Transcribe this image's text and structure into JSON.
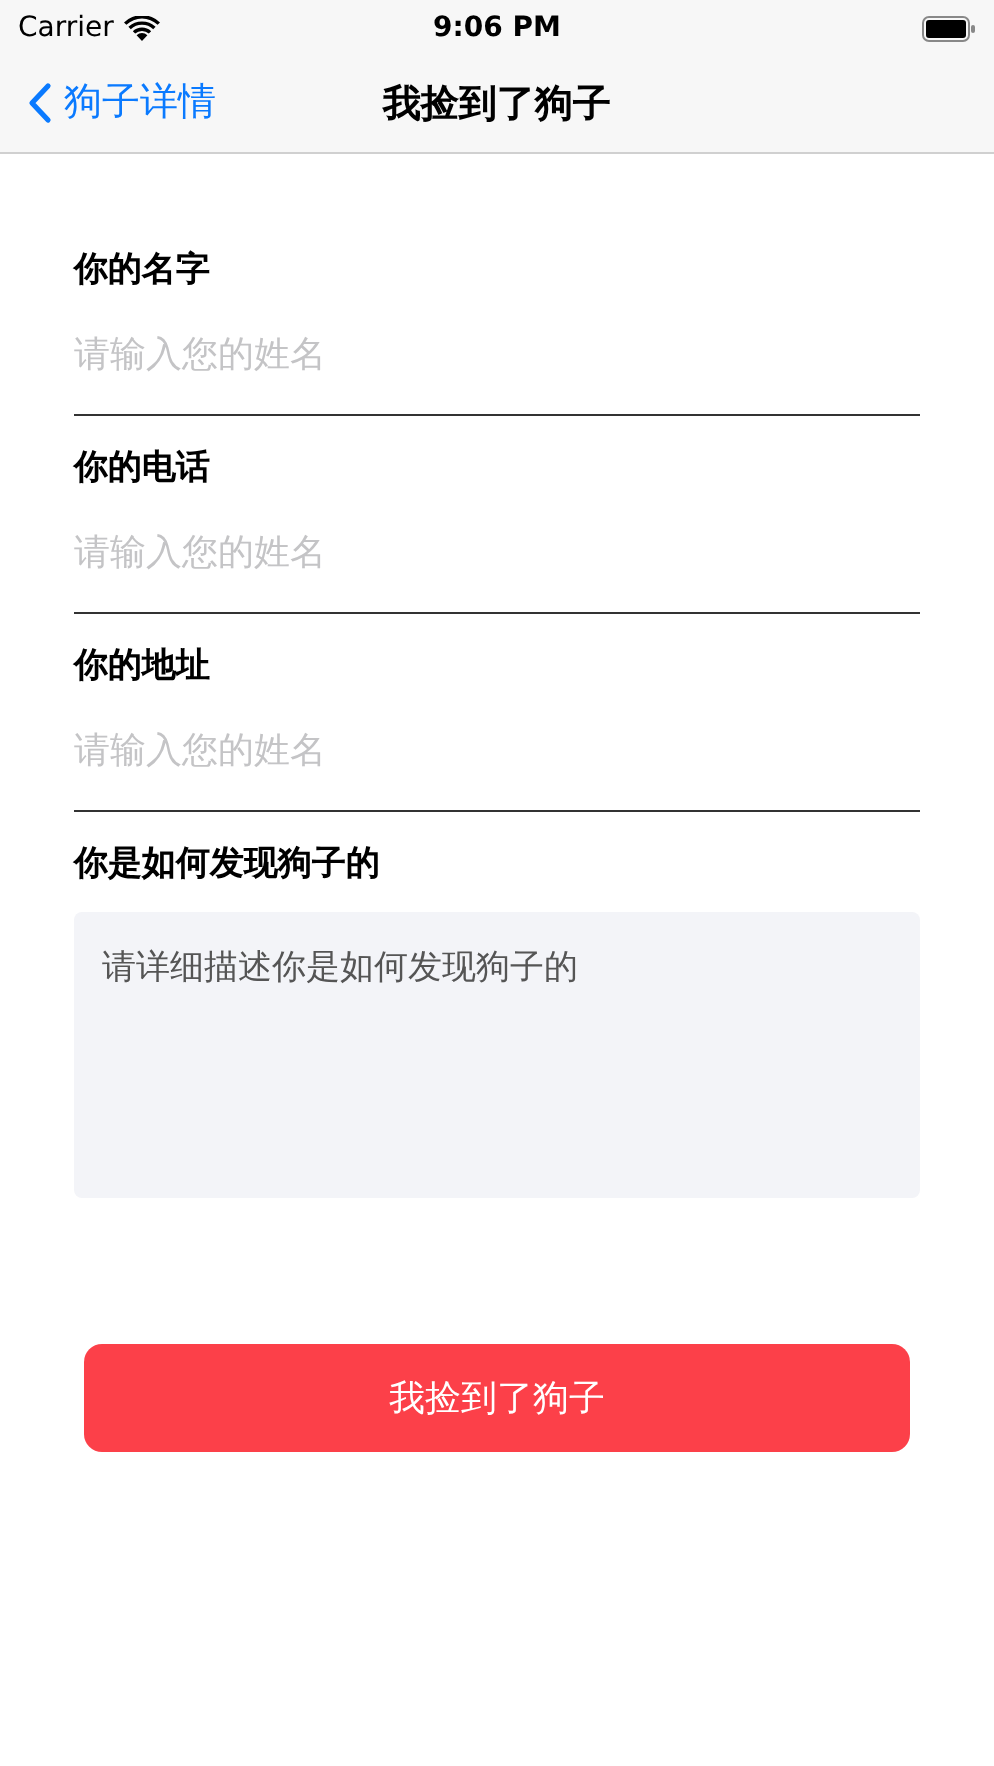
{
  "status_bar": {
    "carrier": "Carrier",
    "time": "9:06 PM"
  },
  "nav": {
    "back_label": "狗子详情",
    "title": "我捡到了狗子"
  },
  "fields": [
    {
      "label": "你的名字",
      "placeholder": "请输入您的姓名"
    },
    {
      "label": "你的电话",
      "placeholder": "请输入您的姓名"
    },
    {
      "label": "你的地址",
      "placeholder": "请输入您的姓名"
    }
  ],
  "description": {
    "label": "你是如何发现狗子的",
    "placeholder": "请详细描述你是如何发现狗子的"
  },
  "submit_button": {
    "label": "我捡到了狗子"
  }
}
